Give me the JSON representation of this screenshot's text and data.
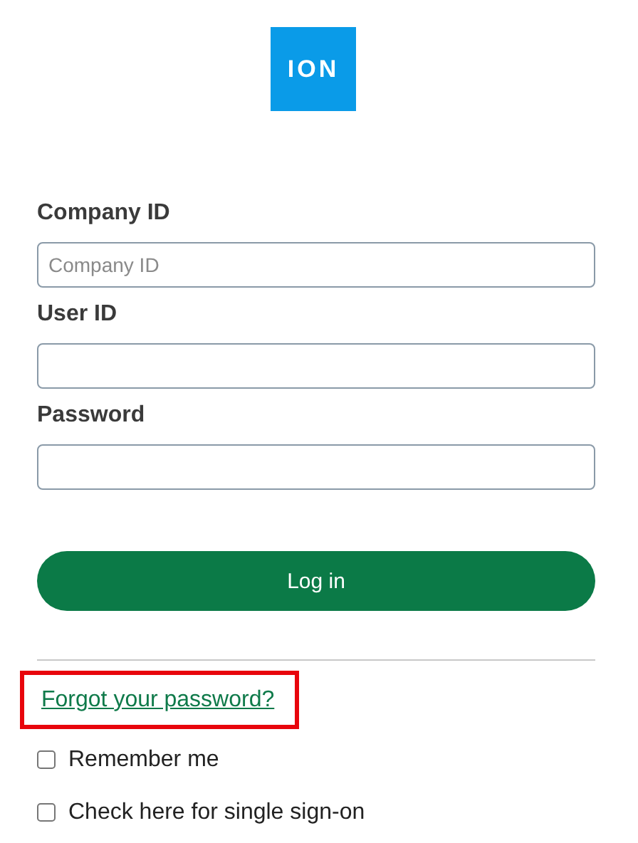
{
  "logo": {
    "text": "ION"
  },
  "fields": [
    {
      "label": "Company ID",
      "placeholder": "Company ID"
    },
    {
      "label": "User ID"
    },
    {
      "label": "Password"
    }
  ],
  "login_button": {
    "label": "Log in"
  },
  "forgot_link": {
    "text": "Forgot your password?",
    "highlighted": true
  },
  "checkboxes": [
    {
      "label": "Remember me",
      "checked": false
    },
    {
      "label": "Check here for single sign-on",
      "checked": false
    }
  ]
}
